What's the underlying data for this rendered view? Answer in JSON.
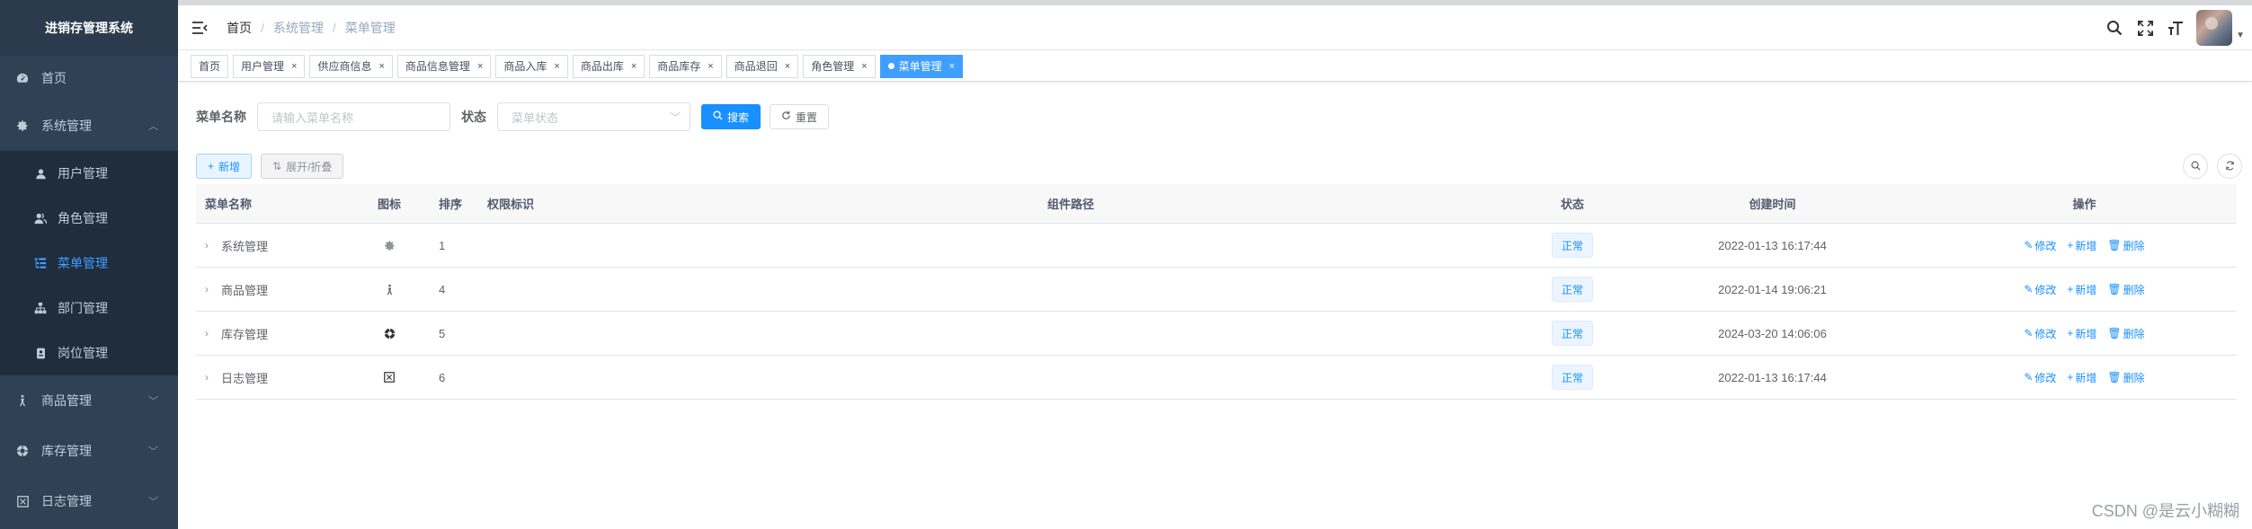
{
  "app": {
    "title": "进销存管理系统"
  },
  "sidebar": {
    "items": [
      {
        "label": "首页",
        "icon": "dashboard-icon"
      },
      {
        "label": "系统管理",
        "icon": "gear-icon",
        "expanded": true,
        "children": [
          {
            "label": "用户管理",
            "icon": "user-icon"
          },
          {
            "label": "角色管理",
            "icon": "peoples-icon"
          },
          {
            "label": "菜单管理",
            "icon": "tree-table-icon",
            "active": true
          },
          {
            "label": "部门管理",
            "icon": "tree-icon"
          },
          {
            "label": "岗位管理",
            "icon": "post-icon"
          }
        ]
      },
      {
        "label": "商品管理",
        "icon": "product-icon"
      },
      {
        "label": "库存管理",
        "icon": "warehouse-icon"
      },
      {
        "label": "日志管理",
        "icon": "log-icon"
      }
    ]
  },
  "header": {
    "breadcrumb": [
      "首页",
      "系统管理",
      "菜单管理"
    ],
    "tools": [
      "search-icon",
      "fullscreen-icon",
      "font-size-icon"
    ]
  },
  "tags": [
    {
      "label": "首页",
      "closable": false
    },
    {
      "label": "用户管理",
      "closable": true
    },
    {
      "label": "供应商信息",
      "closable": true
    },
    {
      "label": "商品信息管理",
      "closable": true
    },
    {
      "label": "商品入库",
      "closable": true
    },
    {
      "label": "商品出库",
      "closable": true
    },
    {
      "label": "商品库存",
      "closable": true
    },
    {
      "label": "商品退回",
      "closable": true
    },
    {
      "label": "角色管理",
      "closable": true
    },
    {
      "label": "菜单管理",
      "closable": true,
      "active": true
    }
  ],
  "search": {
    "menu_name_label": "菜单名称",
    "menu_name_placeholder": "请输入菜单名称",
    "status_label": "状态",
    "status_placeholder": "菜单状态",
    "search_button": "搜索",
    "reset_button": "重置"
  },
  "toolbar": {
    "add_button": "新增",
    "expand_button": "展开/折叠"
  },
  "table": {
    "columns": [
      "菜单名称",
      "图标",
      "排序",
      "权限标识",
      "组件路径",
      "状态",
      "创建时间",
      "操作"
    ],
    "rows": [
      {
        "name": "系统管理",
        "icon": "gear-icon",
        "order": "1",
        "perm": "",
        "component": "",
        "status": "正常",
        "created": "2022-01-13 16:17:44"
      },
      {
        "name": "商品管理",
        "icon": "product-icon",
        "order": "4",
        "perm": "",
        "component": "",
        "status": "正常",
        "created": "2022-01-14 19:06:21"
      },
      {
        "name": "库存管理",
        "icon": "warehouse-icon",
        "order": "5",
        "perm": "",
        "component": "",
        "status": "正常",
        "created": "2024-03-20 14:06:06"
      },
      {
        "name": "日志管理",
        "icon": "log-icon",
        "order": "6",
        "perm": "",
        "component": "",
        "status": "正常",
        "created": "2022-01-13 16:17:44"
      }
    ],
    "actions": {
      "edit": "修改",
      "add": "新增",
      "delete": "删除"
    }
  },
  "watermark": "CSDN @是云小糊糊",
  "colors": {
    "sidebar_bg": "#304156",
    "sidebar_sub_bg": "#1f2d3d",
    "primary": "#1890ff",
    "active_tag": "#409eff"
  }
}
